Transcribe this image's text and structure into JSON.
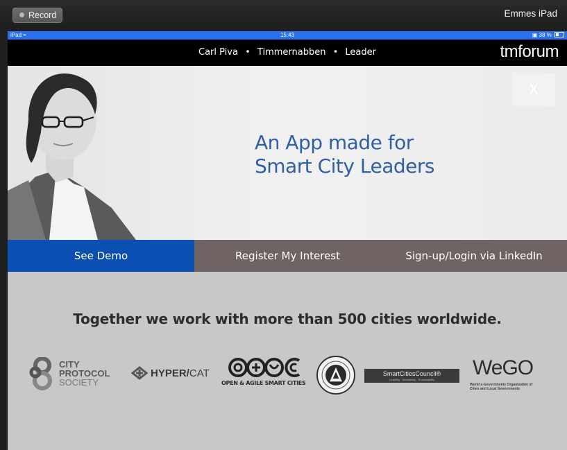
{
  "window": {
    "record_label": "Record",
    "device_name": "Emmes iPad"
  },
  "statusbar": {
    "carrier": "iPad",
    "time": "15:43",
    "battery": "38 %"
  },
  "nav": {
    "crumbs": [
      "Carl Piva",
      "Timmernabben",
      "Leader"
    ],
    "separator": "•",
    "logo": "tmforum"
  },
  "hero": {
    "headline_line1": "An App made for",
    "headline_line2": "Smart City Leaders",
    "close_label": "X"
  },
  "actions": {
    "demo": "See Demo",
    "register": "Register My Interest",
    "linkedin": "Sign-up/Login via LinkedIn"
  },
  "partners": {
    "tagline": "Together we work with more than 500 cities worldwide.",
    "city_protocol": {
      "line1": "CITY",
      "line2": "PROTOCOL",
      "line3": "SOCIETY"
    },
    "hypercat": {
      "hyper": "HYPER/",
      "cat": "CAT"
    },
    "oasc": {
      "caption": "OPEN & AGILE SMART CITIES"
    },
    "smart_cities_council": {
      "name": "SmartCitiesCouncil®",
      "sub": "Livability · Workability · Sustainability"
    },
    "wego": {
      "word": "WeGO",
      "caption_line1": "World e-Governments Organization of",
      "caption_line2": "Cities and Local Governments"
    }
  },
  "colors": {
    "status_blue": "#2a6ff0",
    "demo_blue": "#0b4fb3",
    "action_gray": "#6f6363",
    "headline_blue": "#2f5fa8"
  }
}
